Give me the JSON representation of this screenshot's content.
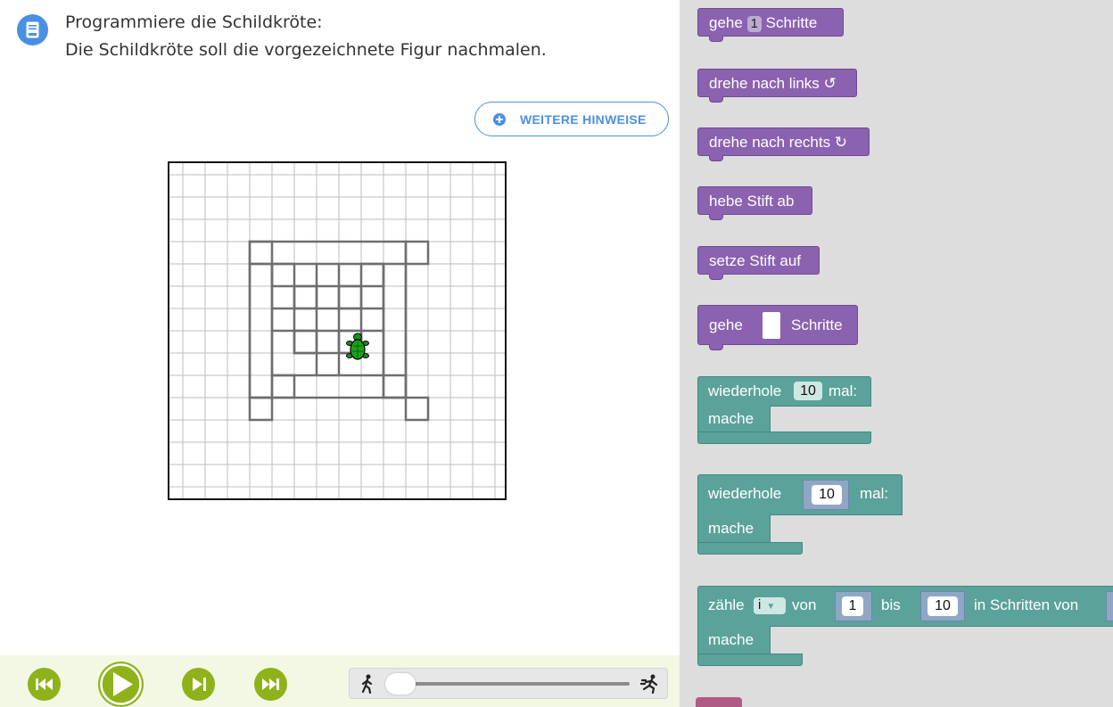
{
  "task": {
    "line1": "Programmiere die Schildkröte:",
    "line2": "Die Schildkröte soll die vorgezeichnete Figur nachmalen."
  },
  "hints_button": {
    "label": "WEITERE HINWEISE"
  },
  "colors": {
    "accent_blue": "#4a90e2",
    "control_green": "#8fb21a",
    "block_purple": "#8b62b0",
    "block_teal": "#5ba39a",
    "toolbox_bg": "#dddddd"
  },
  "icons": {
    "task": "book-icon",
    "restart": "skip-back-icon",
    "play": "play-icon",
    "step": "step-forward-icon",
    "fast_forward": "skip-forward-icon",
    "slow": "walking-person-icon",
    "fast": "running-person-icon"
  },
  "speed_slider": {
    "value": 0
  },
  "toolbox": {
    "gehe_n": {
      "pre": "gehe",
      "value": "1",
      "post": "Schritte"
    },
    "turn_left": "drehe nach links ↺",
    "turn_right": "drehe nach rechts ↻",
    "pen_up": "hebe Stift ab",
    "pen_down": "setze Stift auf",
    "gehe_slot": {
      "pre": "gehe",
      "post": "Schritte"
    },
    "repeat_field": {
      "label": "wiederhole",
      "value": "10",
      "suffix": "mal:",
      "body": "mache"
    },
    "repeat_slot": {
      "label": "wiederhole",
      "value": "10",
      "suffix": "mal:",
      "body": "mache"
    },
    "count": {
      "label": "zähle",
      "var": "i",
      "from": "von",
      "from_value": "1",
      "to": "bis",
      "to_value": "10",
      "step": "in Schritten von",
      "body": "mache"
    }
  }
}
